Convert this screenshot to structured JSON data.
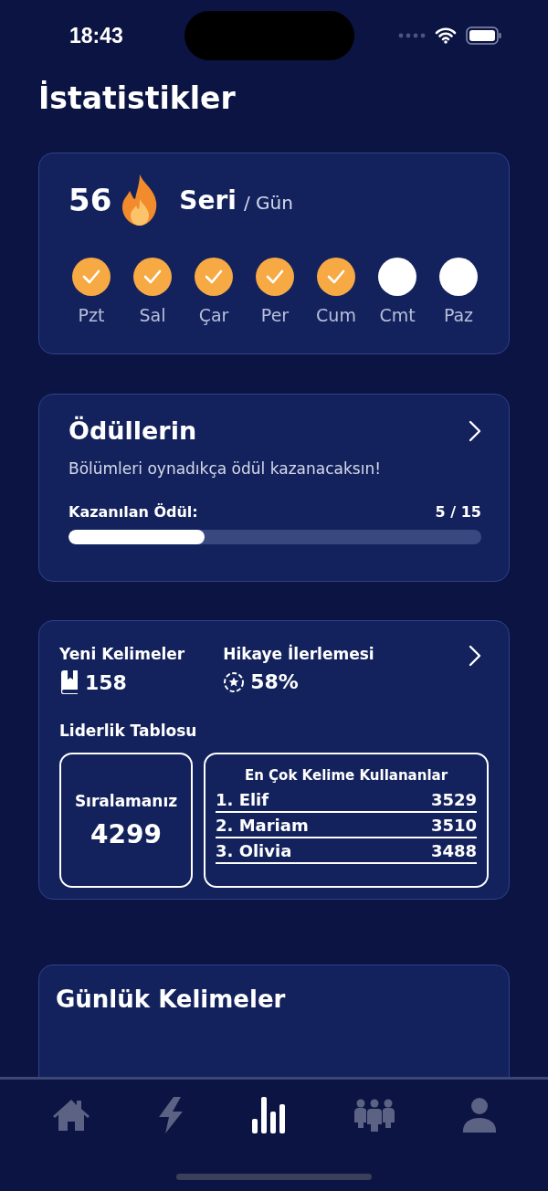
{
  "status_bar": {
    "time": "18:43"
  },
  "title": "İstatistikler",
  "streak": {
    "count": "56",
    "label": "Seri",
    "unit": "/ Gün",
    "days": [
      {
        "label": "Pzt",
        "done": true
      },
      {
        "label": "Sal",
        "done": true
      },
      {
        "label": "Çar",
        "done": true
      },
      {
        "label": "Per",
        "done": true
      },
      {
        "label": "Cum",
        "done": true
      },
      {
        "label": "Cmt",
        "done": false
      },
      {
        "label": "Paz",
        "done": false
      }
    ]
  },
  "rewards": {
    "title": "Ödüllerin",
    "subtitle": "Bölümleri oynadıkça ödül kazanacaksın!",
    "progress_label": "Kazanılan Ödül:",
    "progress_value": "5 / 15",
    "level": 0.33
  },
  "stats": {
    "new_words_label": "Yeni Kelimeler",
    "new_words": "158",
    "story_label": "Hikaye İlerlemesi",
    "story": "58%",
    "leaderboard_title": "Liderlik Tablosu",
    "rank_label": "Sıralamanız",
    "rank": "4299",
    "top_title": "En Çok Kelime Kullananlar",
    "top": [
      {
        "name": "1. Elif",
        "score": "3529"
      },
      {
        "name": "2. Mariam",
        "score": "3510"
      },
      {
        "name": "3. Olivia",
        "score": "3488"
      }
    ]
  },
  "daily": {
    "title": "Günlük Kelimeler"
  },
  "nav": {
    "items": [
      {
        "kind": "home",
        "selected": false
      },
      {
        "kind": "bolt",
        "selected": false
      },
      {
        "kind": "chart",
        "selected": true
      },
      {
        "kind": "group",
        "selected": false
      },
      {
        "kind": "person",
        "selected": false
      }
    ]
  }
}
